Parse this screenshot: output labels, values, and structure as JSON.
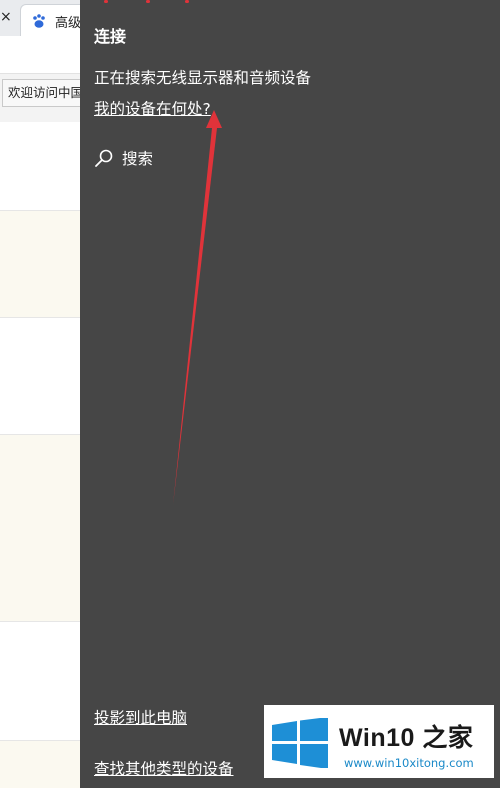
{
  "browser": {
    "tab_close_glyph": "×",
    "tab_title": "高级",
    "bookmark_label": "欢迎访问中国"
  },
  "panel": {
    "title": "连接",
    "searching_text": "正在搜索无线显示器和音频设备",
    "where_link": "我的设备在何处?",
    "search_label": "搜索",
    "footer_links": [
      "投影到此电脑",
      "查找其他类型的设备"
    ]
  },
  "watermark": {
    "title": "Win10 之家",
    "site": "www.win10xitong.com"
  },
  "colors": {
    "panel_bg": "#464646",
    "arrow": "#e0333a",
    "win_blue": "#1e8fd6"
  },
  "icons": [
    "close-icon",
    "baidu-paw-icon",
    "search-icon",
    "windows-logo-icon"
  ]
}
